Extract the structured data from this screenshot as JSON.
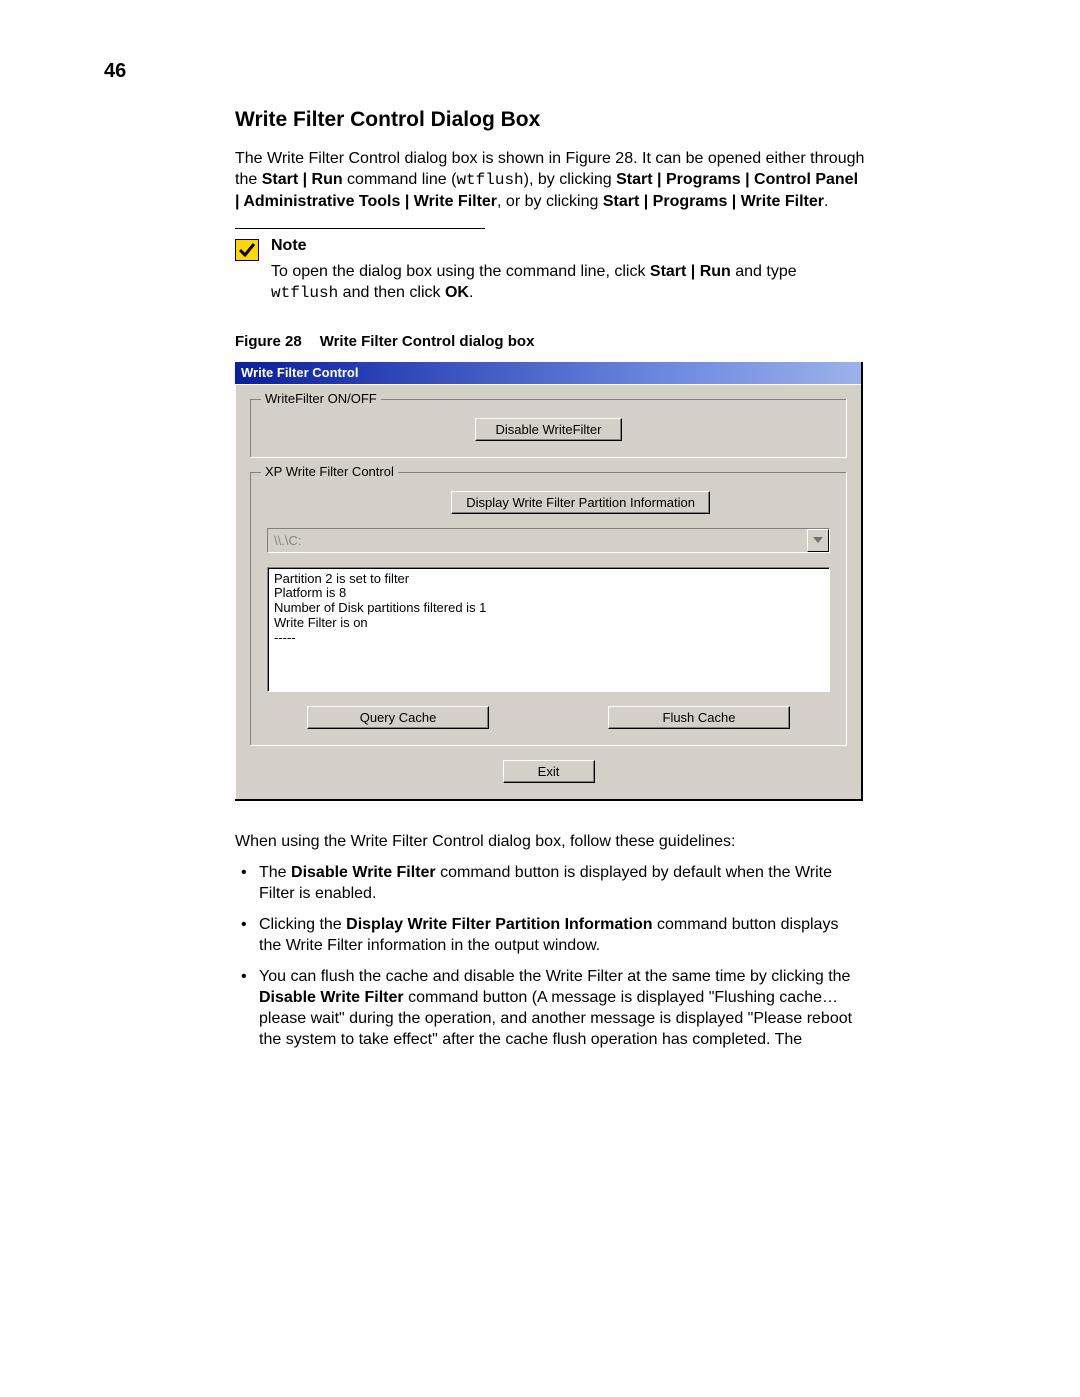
{
  "page_number": "46",
  "heading": "Write Filter Control Dialog Box",
  "intro": {
    "t1": "The Write Filter Control dialog box is shown in Figure 28. It can be opened either through the ",
    "b1": "Start | Run",
    "t2": " command line (",
    "m1": "wtflush",
    "t3": "), by clicking ",
    "b2": "Start | Programs | Control Panel | Administrative Tools | Write Filter",
    "t4": ", or by clicking ",
    "b3": "Start | Programs | Write Filter",
    "t5": "."
  },
  "note": {
    "title": "Note",
    "t1": "To open the dialog box using the command line, click ",
    "b1": "Start | Run",
    "t2": " and type ",
    "m1": "wtflush",
    "t3": " and then click ",
    "b2": "OK",
    "t4": "."
  },
  "figure": {
    "num": "Figure 28",
    "title": "Write Filter Control dialog box"
  },
  "dialog": {
    "title": "Write Filter Control",
    "group1": {
      "legend": "WriteFilter ON/OFF",
      "disable_btn": "Disable WriteFilter"
    },
    "group2": {
      "legend": "XP Write Filter Control",
      "display_btn": "Display Write Filter Partition Information",
      "combo_value": "\\\\.\\C:",
      "output": "Partition 2 is set to filter\nPlatform is 8\nNumber of Disk partitions filtered is 1\nWrite Filter is on\n-----",
      "query_btn": "Query Cache",
      "flush_btn": "Flush Cache"
    },
    "exit_btn": "Exit"
  },
  "guidelines_intro": "When using the Write Filter Control dialog box, follow these guidelines:",
  "bullets": {
    "b0": {
      "t1": "The ",
      "s1": "Disable Write Filter",
      "t2": " command button is displayed by default when the Write Filter is enabled."
    },
    "b1": {
      "t1": "Clicking the ",
      "s1": "Display Write Filter Partition Information",
      "t2": " command button displays the Write Filter information in the output window."
    },
    "b2": {
      "t1": "You can flush the cache and disable the Write Filter at the same time by clicking the ",
      "s1": "Disable Write Filter",
      "t2": " command button (A message is displayed \"Flushing cache…please wait\" during the operation, and another message is displayed \"Please reboot the system to take effect\" after the cache flush operation has completed. The"
    }
  }
}
